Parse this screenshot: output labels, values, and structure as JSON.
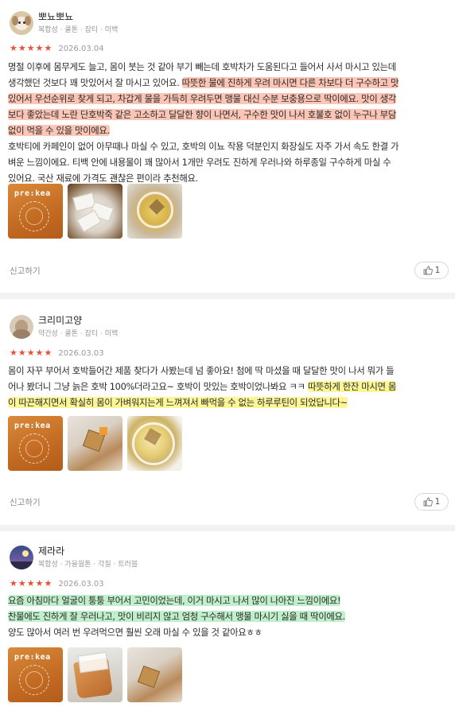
{
  "reviews": [
    {
      "username": "뽀뇨뽀뇨",
      "skin_tags": "복합성 · 쿨톤 · 잡티 · 미백",
      "rating": 5,
      "date": "2026.03.04",
      "avatar_icon": "puppy-avatar-icon",
      "text_lines": [
        {
          "segments": [
            {
              "text": "명절 이후에 몸무게도 늘고, 몸이 붓는 것 같아 부기 빼는데 호박차가 도움된다고 들어서 사서 마시고 있는데",
              "hl": ""
            }
          ]
        },
        {
          "segments": [
            {
              "text": "생각했던 것보다 꽤 맛있어서 잘 마시고 있어요. ",
              "hl": ""
            },
            {
              "text": "따뜻한 물에 진하게 우려 마시면 다른 차보다 더 구수하고 맛",
              "hl": "orange"
            }
          ]
        },
        {
          "segments": [
            {
              "text": "있어서 우선순위로 찾게 되고, 차갑게 물을 가득히 우려두면 맹물 대신 수분 보충용으로 딱이에요. 맛이 생각",
              "hl": "orange"
            }
          ]
        },
        {
          "segments": [
            {
              "text": "보다 좋았는데 노란 단호박죽 같은 고소하고 달달한 향이 나면서, 구수한 맛이 나서 호불호 없이 누구나 부담",
              "hl": "orange"
            }
          ]
        },
        {
          "segments": [
            {
              "text": "없이 먹을 수 있을 맛이에요.",
              "hl": "orange"
            }
          ]
        },
        {
          "segments": [
            {
              "text": "호박티에 카페인이 없어 아무때나 마실 수 있고, 호박의 이뇨 작용 덕분인지 화장실도 자주 가서 속도 한결 가",
              "hl": ""
            }
          ]
        },
        {
          "segments": [
            {
              "text": "벼운 느낌이에요. 티백 안에 내용물이 꽤 많아서 1개만 우려도 진하게 우러나와 하루종일 구수하게 마실 수",
              "hl": ""
            }
          ]
        },
        {
          "segments": [
            {
              "text": "있어요. 국산 재료에 가격도 괜찮은 편이라 추천해요.",
              "hl": ""
            }
          ]
        }
      ],
      "report_label": "신고하기",
      "like_count": "1"
    },
    {
      "username": "크리미고양",
      "skin_tags": "약건성 · 쿨톤 · 잡티 · 미백",
      "rating": 5,
      "date": "2026.03.03",
      "avatar_icon": "cat-avatar-icon",
      "text_lines": [
        {
          "segments": [
            {
              "text": "몸이 자꾸 부어서 호박들어간 제품 찾다가 사봤는데 넘 좋아요! 첨에 딱 마셨을 때 달달한 맛이 나서 뭐가 들",
              "hl": ""
            }
          ]
        },
        {
          "segments": [
            {
              "text": "어나 봤더니 그냥 늙은 호박 100%더라고요~ 호박이 맛있는 호박이었나봐요 ㅋㅋ ",
              "hl": ""
            },
            {
              "text": "따뜻하게 한잔 마시면 몸",
              "hl": "yellow"
            }
          ]
        },
        {
          "segments": [
            {
              "text": "이 따끈해지면서 확실히 몸이 가벼워지는게 느껴져서 빠먹을 수 없는 하루루틴이 되었답니다~",
              "hl": "yellow"
            }
          ]
        }
      ],
      "report_label": "신고하기",
      "like_count": "1"
    },
    {
      "username": "제라라",
      "skin_tags": "복합성 · 가을웜톤 · 각질 · 트러블",
      "rating": 5,
      "date": "2026.03.03",
      "avatar_icon": "night-sky-avatar-icon",
      "text_lines": [
        {
          "segments": [
            {
              "text": "요즘 아침마다 얼굴이 퉁퉁 부어서 고민이었는데, 이거 마시고 나서 많이 나아진 느낌이에요!",
              "hl": "green"
            }
          ]
        },
        {
          "segments": [
            {
              "text": "찬물에도 진하게 잘 우러나고, 맛이 비리지 않고 엄청 구수해서 맹물 마시기 싫을 때 딱이에요.",
              "hl": "green"
            }
          ]
        },
        {
          "segments": [
            {
              "text": "양도 많아서 여러 번 우려먹으면 훨씬 오래 마실 수 있을 것 같아요ㅎㅎ",
              "hl": ""
            }
          ]
        }
      ]
    }
  ],
  "brand_text": "pre:kea",
  "colors": {
    "star": "#e8503a",
    "highlight_orange": "#fa9678",
    "highlight_yellow": "#faf050",
    "highlight_green": "#8ce1a0"
  }
}
